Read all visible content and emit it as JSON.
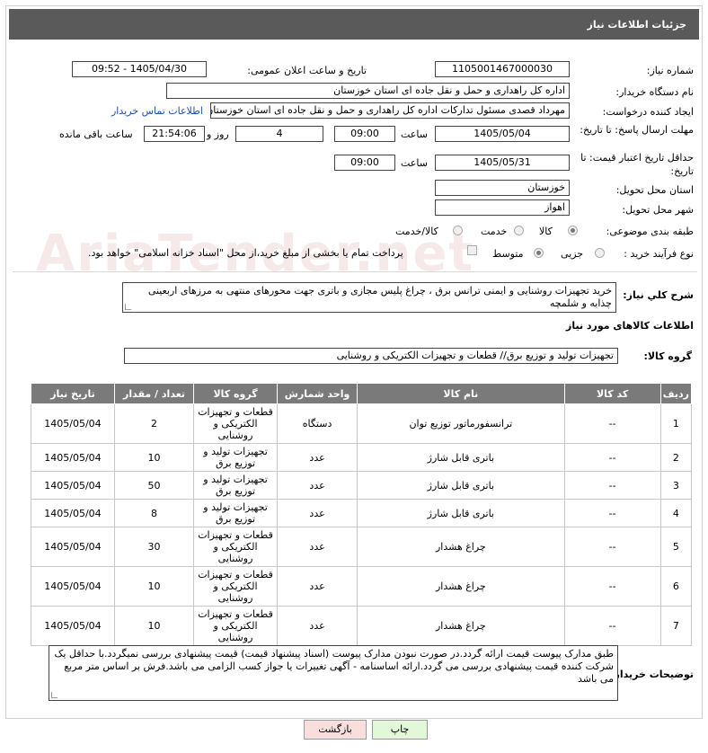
{
  "window": {
    "title": "جزئیات اطلاعات نیاز"
  },
  "fields": {
    "need_number_label": "شماره نیاز:",
    "need_number": "1105001467000030",
    "announce_label": "تاریخ و ساعت اعلان عمومی:",
    "announce_value": "1405/04/30 - 09:52",
    "buyer_org_label": "نام دستگاه خریدار:",
    "buyer_org": "اداره کل راهداری و حمل و نقل جاده ای استان خوزستان",
    "creator_label": "ایجاد کننده درخواست:",
    "creator": "مهرداد قصدی مسئول تدارکات اداره کل راهداری و حمل و نقل جاده ای استان خوزستان",
    "contact_link": "اطلاعات تماس خریدار",
    "reply_deadline_label": "مهلت ارسال پاسخ: تا تاریخ:",
    "reply_date": "1405/05/04",
    "time_label": "ساعت",
    "reply_time": "09:00",
    "days_value": "4",
    "days_label": "روز و",
    "remaining_time": "21:54:06",
    "remaining_label": "ساعت باقی مانده",
    "price_validity_label": "حداقل تاریخ اعتبار قیمت: تا تاریخ:",
    "validity_date": "1405/05/31",
    "validity_time": "09:00",
    "province_label": "استان محل تحویل:",
    "province": "خوزستان",
    "city_label": "شهر محل تحویل:",
    "city": "اهواز",
    "category_label": "طبقه بندی موضوعی:",
    "category_options": [
      "کالا",
      "خدمت",
      "کالا/خدمت"
    ],
    "process_label": "نوع فرآیند خرید :",
    "process_options": [
      "جزیی",
      "متوسط"
    ],
    "payment_note": "پرداخت تمام یا بخشی از مبلغ خرید،از محل \"اسناد خزانه اسلامی\" خواهد بود."
  },
  "summary": {
    "label": "شرح کلي نياز:",
    "text": "خرید تجهیزات روشنایی و ایمنی ترانس برق ، چراغ پلیس مجازی و باتری جهت محورهای منتهی به مرزهای اربعینی چذابه و شلمچه"
  },
  "goods_info": {
    "title": "اطلاعات کالاهای مورد نیاز"
  },
  "goods_group": {
    "label": "گروه کالا:",
    "value": "تجهیزات تولید و توزیع برق// قطعات و تجهیزات الکتریکی و روشنایی"
  },
  "table": {
    "headers": [
      "ردیف",
      "کد کالا",
      "نام کالا",
      "واحد شمارش",
      "گروه کالا",
      "تعداد / مقدار",
      "تاریخ نیاز"
    ],
    "rows": [
      [
        "1",
        "--",
        "ترانسفورماتور توزیع توان",
        "دستگاه",
        "قطعات و تجهیزات الکتریکی و روشنایی",
        "2",
        "1405/05/04"
      ],
      [
        "2",
        "--",
        "باتری قابل شارژ",
        "عدد",
        "تجهیزات تولید و توزیع برق",
        "10",
        "1405/05/04"
      ],
      [
        "3",
        "--",
        "باتری قابل شارژ",
        "عدد",
        "تجهیزات تولید و توزیع برق",
        "50",
        "1405/05/04"
      ],
      [
        "4",
        "--",
        "باتری قابل شارژ",
        "عدد",
        "تجهیزات تولید و توزیع برق",
        "8",
        "1405/05/04"
      ],
      [
        "5",
        "--",
        "چراغ هشدار",
        "عدد",
        "قطعات و تجهیزات الکتریکی و روشنایی",
        "30",
        "1405/05/04"
      ],
      [
        "6",
        "--",
        "چراغ هشدار",
        "عدد",
        "قطعات و تجهیزات الکتریکی و روشنایی",
        "10",
        "1405/05/04"
      ],
      [
        "7",
        "--",
        "چراغ هشدار",
        "عدد",
        "قطعات و تجهیزات الکتریکی و روشنایی",
        "10",
        "1405/05/04"
      ]
    ]
  },
  "buyer_notes": {
    "label": "توضیحات خریدار:",
    "text": "طبق مدارک پیوست قیمت ارائه گردد.در صورت نبودن مدارک پیوست (اسناد پیشنهاد قیمت) قیمت پیشنهادی بررسی نمیگردد.با حداقل یک شرکت کننده قیمت پیشنهادی بررسی می گردد.ارائه اساسنامه - آگهی تغییرات یا جواز کسب الزامی می باشد.فرش بر اساس متر مربع می باشد"
  },
  "buttons": {
    "print": "چاپ",
    "back": "بازگشت"
  },
  "colors": {
    "title_bar": "#5a5a5a",
    "table_header": "#7a7a7a",
    "print_btn": "#e3f7d9",
    "back_btn": "#f9dede",
    "link": "#1a4fb5"
  }
}
